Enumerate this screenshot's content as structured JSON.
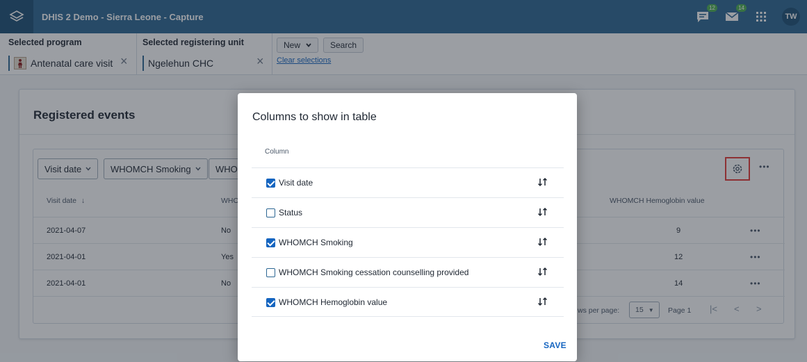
{
  "header": {
    "app_title": "DHIS 2 Demo - Sierra Leone - Capture",
    "messages_badge": "12",
    "email_badge": "14",
    "avatar_initials": "TW"
  },
  "selection": {
    "program_label": "Selected program",
    "program_value": "Antenatal care visit",
    "org_label": "Selected registering unit",
    "org_value": "Ngelehun CHC",
    "new_label": "New",
    "search_label": "Search",
    "clear_label": "Clear selections"
  },
  "card": {
    "title": "Registered events",
    "filters": [
      "Visit date",
      "WHOMCH Smoking",
      "WHOM"
    ],
    "columns": {
      "visit_date": "Visit date",
      "smoking": "WHO",
      "hemoglobin": "WHOMCH Hemoglobin value"
    },
    "rows": [
      {
        "date": "2021-04-07",
        "smoking": "No",
        "hb": "9"
      },
      {
        "date": "2021-04-01",
        "smoking": "Yes",
        "hb": "12"
      },
      {
        "date": "2021-04-01",
        "smoking": "No",
        "hb": "14"
      }
    ],
    "pager": {
      "rows_label": "ws per page:",
      "rows_value": "15",
      "page_label": "Page 1"
    }
  },
  "modal": {
    "title": "Columns to show in table",
    "column_header": "Column",
    "items": [
      {
        "label": "Visit date",
        "checked": true
      },
      {
        "label": "Status",
        "checked": false
      },
      {
        "label": "WHOMCH Smoking",
        "checked": true
      },
      {
        "label": "WHOMCH Smoking cessation counselling provided",
        "checked": false
      },
      {
        "label": "WHOMCH Hemoglobin value",
        "checked": true
      }
    ],
    "save_label": "SAVE"
  }
}
